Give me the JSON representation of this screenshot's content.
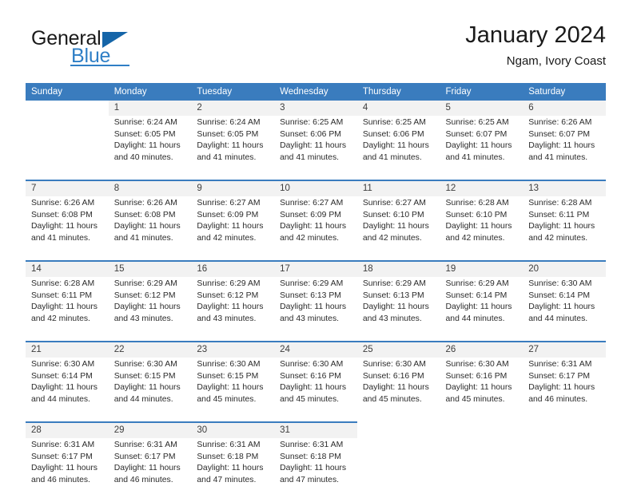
{
  "brand": {
    "word1": "General",
    "word2": "Blue",
    "logo_icon": "triangle-logo-icon"
  },
  "header": {
    "title": "January 2024",
    "subtitle": "Ngam, Ivory Coast"
  },
  "calendar": {
    "weekday_headers": [
      "Sunday",
      "Monday",
      "Tuesday",
      "Wednesday",
      "Thursday",
      "Friday",
      "Saturday"
    ],
    "accent_color": "#3a7cbe",
    "daynum_bg": "#f2f2f2",
    "weeks": [
      [
        {
          "day": "",
          "lines": []
        },
        {
          "day": "1",
          "lines": [
            "Sunrise: 6:24 AM",
            "Sunset: 6:05 PM",
            "Daylight: 11 hours",
            "and 40 minutes."
          ]
        },
        {
          "day": "2",
          "lines": [
            "Sunrise: 6:24 AM",
            "Sunset: 6:05 PM",
            "Daylight: 11 hours",
            "and 41 minutes."
          ]
        },
        {
          "day": "3",
          "lines": [
            "Sunrise: 6:25 AM",
            "Sunset: 6:06 PM",
            "Daylight: 11 hours",
            "and 41 minutes."
          ]
        },
        {
          "day": "4",
          "lines": [
            "Sunrise: 6:25 AM",
            "Sunset: 6:06 PM",
            "Daylight: 11 hours",
            "and 41 minutes."
          ]
        },
        {
          "day": "5",
          "lines": [
            "Sunrise: 6:25 AM",
            "Sunset: 6:07 PM",
            "Daylight: 11 hours",
            "and 41 minutes."
          ]
        },
        {
          "day": "6",
          "lines": [
            "Sunrise: 6:26 AM",
            "Sunset: 6:07 PM",
            "Daylight: 11 hours",
            "and 41 minutes."
          ]
        }
      ],
      [
        {
          "day": "7",
          "lines": [
            "Sunrise: 6:26 AM",
            "Sunset: 6:08 PM",
            "Daylight: 11 hours",
            "and 41 minutes."
          ]
        },
        {
          "day": "8",
          "lines": [
            "Sunrise: 6:26 AM",
            "Sunset: 6:08 PM",
            "Daylight: 11 hours",
            "and 41 minutes."
          ]
        },
        {
          "day": "9",
          "lines": [
            "Sunrise: 6:27 AM",
            "Sunset: 6:09 PM",
            "Daylight: 11 hours",
            "and 42 minutes."
          ]
        },
        {
          "day": "10",
          "lines": [
            "Sunrise: 6:27 AM",
            "Sunset: 6:09 PM",
            "Daylight: 11 hours",
            "and 42 minutes."
          ]
        },
        {
          "day": "11",
          "lines": [
            "Sunrise: 6:27 AM",
            "Sunset: 6:10 PM",
            "Daylight: 11 hours",
            "and 42 minutes."
          ]
        },
        {
          "day": "12",
          "lines": [
            "Sunrise: 6:28 AM",
            "Sunset: 6:10 PM",
            "Daylight: 11 hours",
            "and 42 minutes."
          ]
        },
        {
          "day": "13",
          "lines": [
            "Sunrise: 6:28 AM",
            "Sunset: 6:11 PM",
            "Daylight: 11 hours",
            "and 42 minutes."
          ]
        }
      ],
      [
        {
          "day": "14",
          "lines": [
            "Sunrise: 6:28 AM",
            "Sunset: 6:11 PM",
            "Daylight: 11 hours",
            "and 42 minutes."
          ]
        },
        {
          "day": "15",
          "lines": [
            "Sunrise: 6:29 AM",
            "Sunset: 6:12 PM",
            "Daylight: 11 hours",
            "and 43 minutes."
          ]
        },
        {
          "day": "16",
          "lines": [
            "Sunrise: 6:29 AM",
            "Sunset: 6:12 PM",
            "Daylight: 11 hours",
            "and 43 minutes."
          ]
        },
        {
          "day": "17",
          "lines": [
            "Sunrise: 6:29 AM",
            "Sunset: 6:13 PM",
            "Daylight: 11 hours",
            "and 43 minutes."
          ]
        },
        {
          "day": "18",
          "lines": [
            "Sunrise: 6:29 AM",
            "Sunset: 6:13 PM",
            "Daylight: 11 hours",
            "and 43 minutes."
          ]
        },
        {
          "day": "19",
          "lines": [
            "Sunrise: 6:29 AM",
            "Sunset: 6:14 PM",
            "Daylight: 11 hours",
            "and 44 minutes."
          ]
        },
        {
          "day": "20",
          "lines": [
            "Sunrise: 6:30 AM",
            "Sunset: 6:14 PM",
            "Daylight: 11 hours",
            "and 44 minutes."
          ]
        }
      ],
      [
        {
          "day": "21",
          "lines": [
            "Sunrise: 6:30 AM",
            "Sunset: 6:14 PM",
            "Daylight: 11 hours",
            "and 44 minutes."
          ]
        },
        {
          "day": "22",
          "lines": [
            "Sunrise: 6:30 AM",
            "Sunset: 6:15 PM",
            "Daylight: 11 hours",
            "and 44 minutes."
          ]
        },
        {
          "day": "23",
          "lines": [
            "Sunrise: 6:30 AM",
            "Sunset: 6:15 PM",
            "Daylight: 11 hours",
            "and 45 minutes."
          ]
        },
        {
          "day": "24",
          "lines": [
            "Sunrise: 6:30 AM",
            "Sunset: 6:16 PM",
            "Daylight: 11 hours",
            "and 45 minutes."
          ]
        },
        {
          "day": "25",
          "lines": [
            "Sunrise: 6:30 AM",
            "Sunset: 6:16 PM",
            "Daylight: 11 hours",
            "and 45 minutes."
          ]
        },
        {
          "day": "26",
          "lines": [
            "Sunrise: 6:30 AM",
            "Sunset: 6:16 PM",
            "Daylight: 11 hours",
            "and 45 minutes."
          ]
        },
        {
          "day": "27",
          "lines": [
            "Sunrise: 6:31 AM",
            "Sunset: 6:17 PM",
            "Daylight: 11 hours",
            "and 46 minutes."
          ]
        }
      ],
      [
        {
          "day": "28",
          "lines": [
            "Sunrise: 6:31 AM",
            "Sunset: 6:17 PM",
            "Daylight: 11 hours",
            "and 46 minutes."
          ]
        },
        {
          "day": "29",
          "lines": [
            "Sunrise: 6:31 AM",
            "Sunset: 6:17 PM",
            "Daylight: 11 hours",
            "and 46 minutes."
          ]
        },
        {
          "day": "30",
          "lines": [
            "Sunrise: 6:31 AM",
            "Sunset: 6:18 PM",
            "Daylight: 11 hours",
            "and 47 minutes."
          ]
        },
        {
          "day": "31",
          "lines": [
            "Sunrise: 6:31 AM",
            "Sunset: 6:18 PM",
            "Daylight: 11 hours",
            "and 47 minutes."
          ]
        },
        {
          "day": "",
          "lines": []
        },
        {
          "day": "",
          "lines": []
        },
        {
          "day": "",
          "lines": []
        }
      ]
    ]
  }
}
